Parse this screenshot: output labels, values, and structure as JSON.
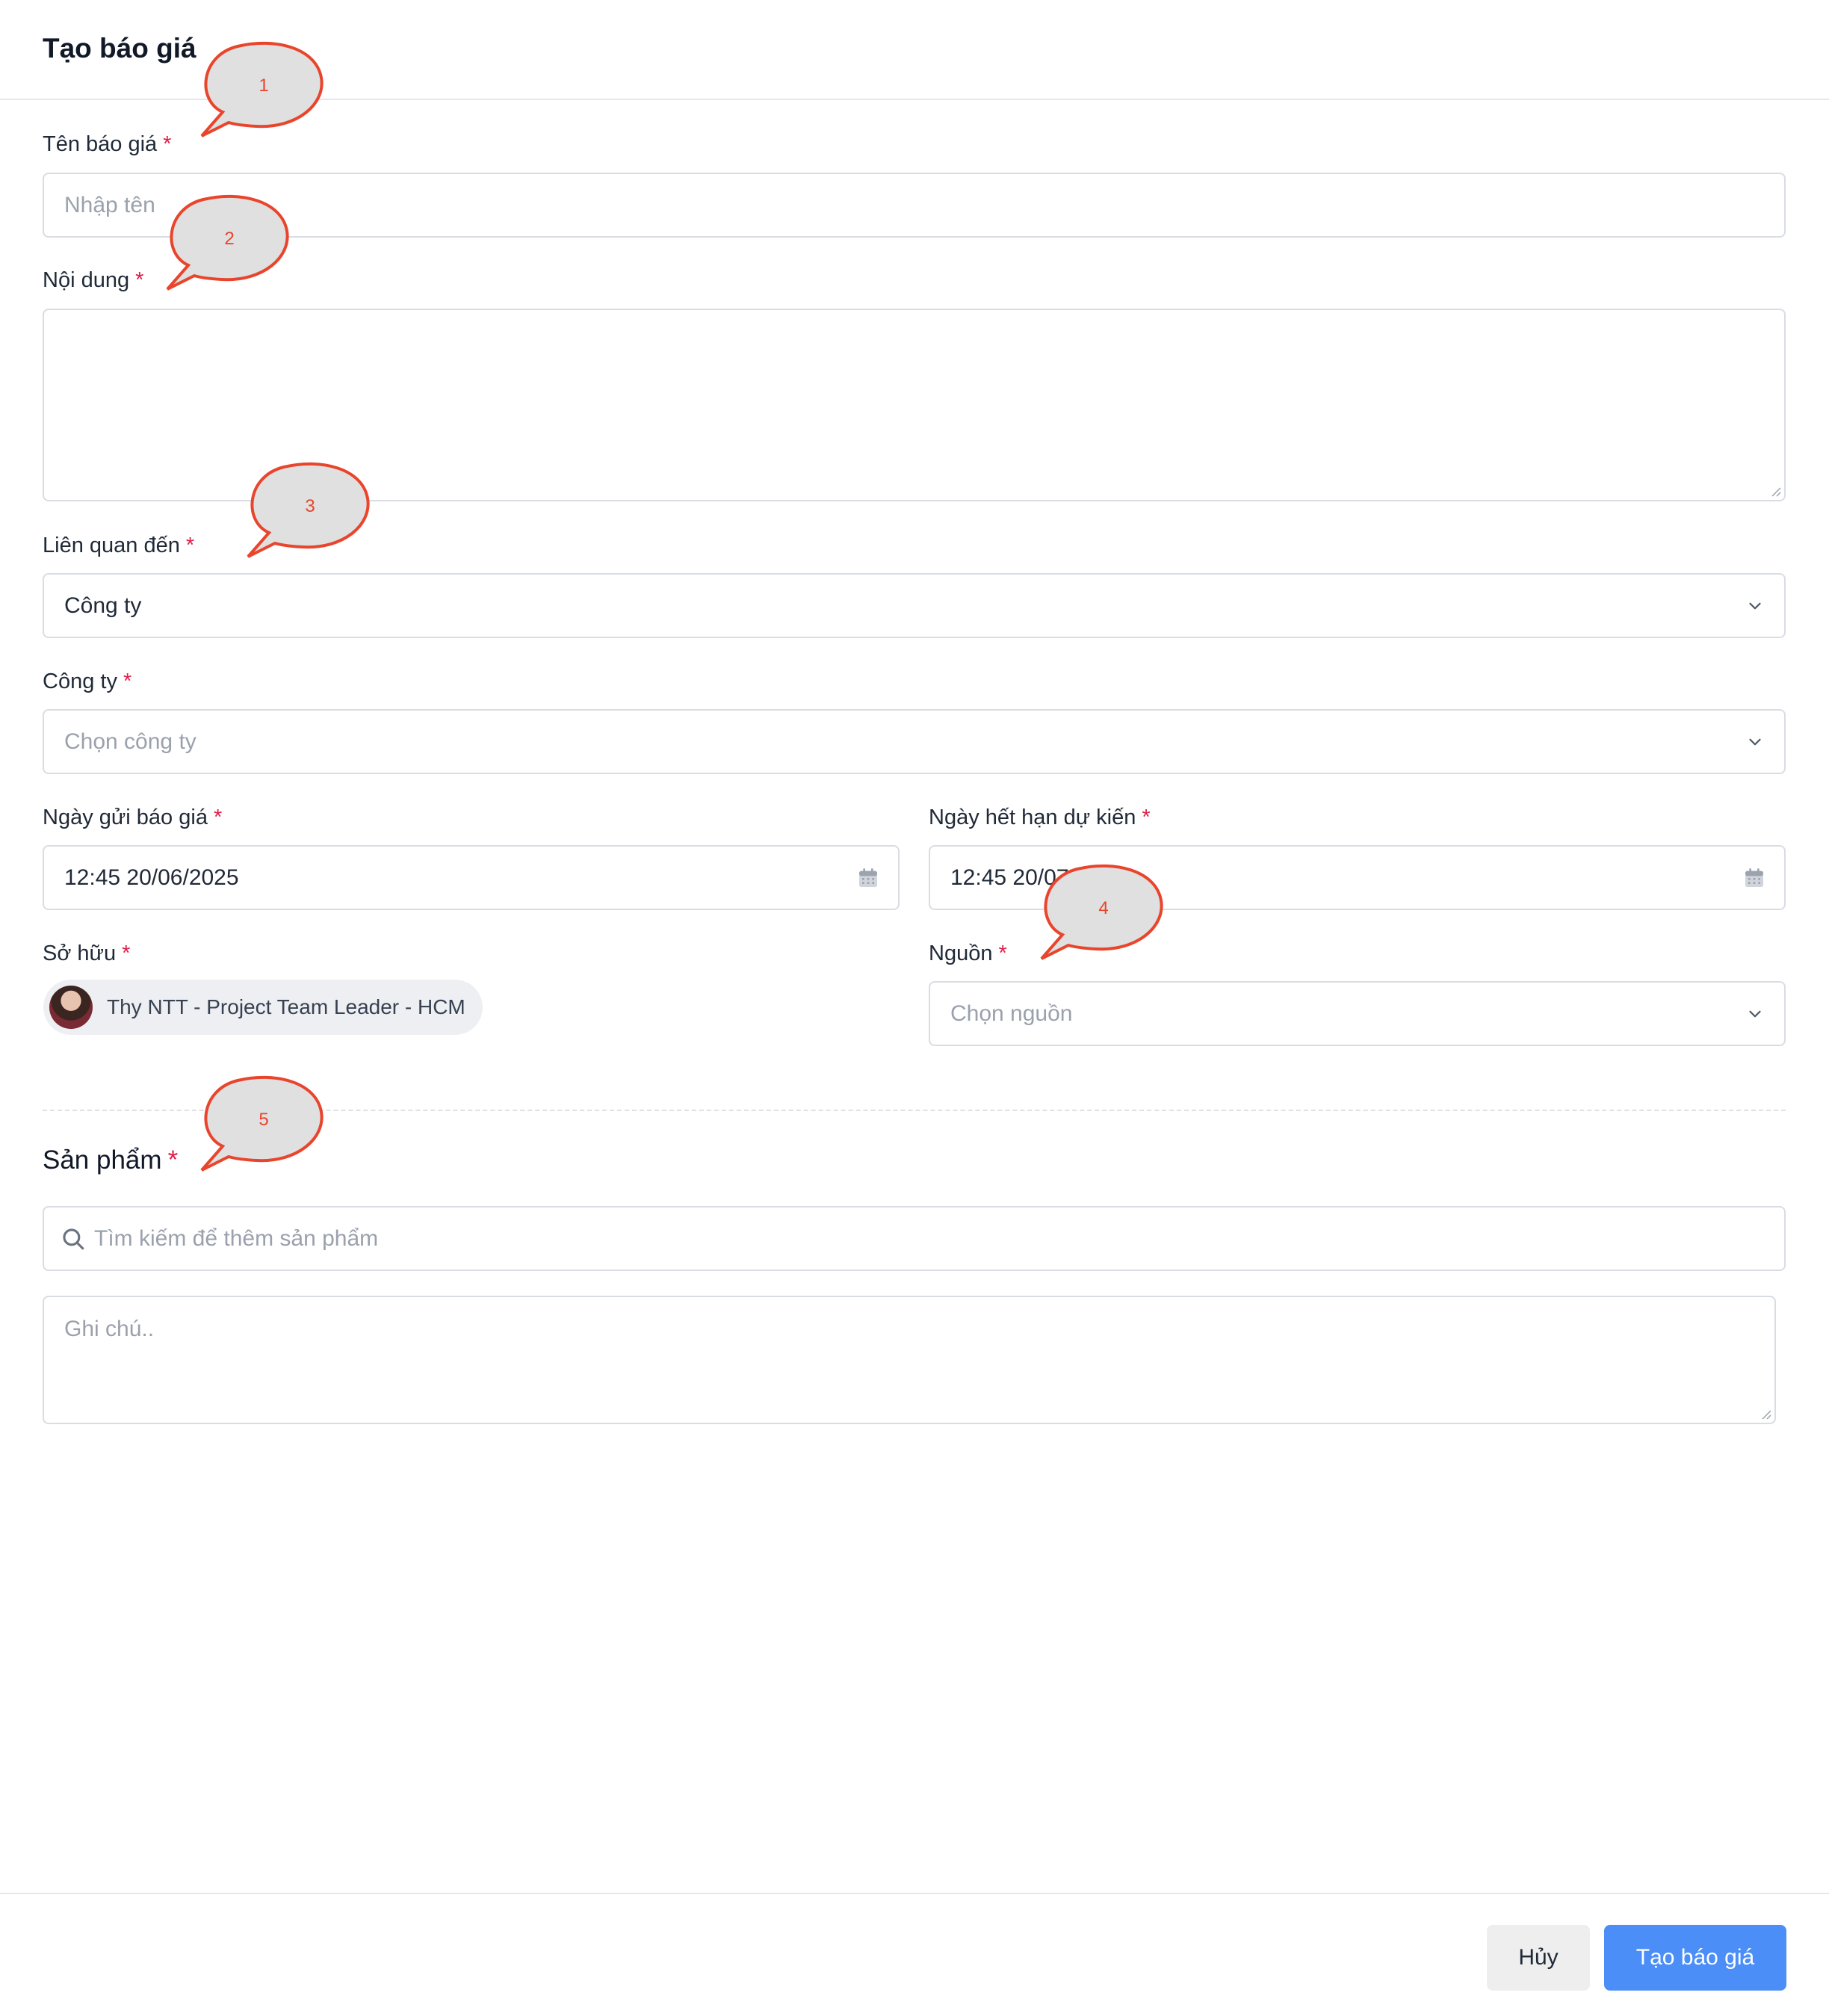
{
  "header": {
    "title": "Tạo báo giá"
  },
  "form": {
    "name_label": "Tên báo giá",
    "name_placeholder": "Nhập tên",
    "content_label": "Nội dung",
    "related_label": "Liên quan đến",
    "related_value": "Công ty",
    "company_label": "Công ty",
    "company_placeholder": "Chọn công ty",
    "send_date_label": "Ngày gửi báo giá",
    "send_date_value": "12:45 20/06/2025",
    "expiry_label": "Ngày hết hạn dự kiến",
    "expiry_value": "12:45 20/07/2025",
    "owner_label": "Sở hữu",
    "owner_name": "Thy NTT - Project Team Leader - HCM",
    "source_label": "Nguồn",
    "source_placeholder": "Chọn nguồn",
    "required_mark": "*"
  },
  "products": {
    "title": "Sản phẩm",
    "search_placeholder": "Tìm kiếm để thêm sản phẩm",
    "note_placeholder": "Ghi chú.."
  },
  "footer": {
    "cancel_label": "Hủy",
    "submit_label": "Tạo báo giá"
  },
  "annotations": [
    "1",
    "2",
    "3",
    "4",
    "5"
  ],
  "colors": {
    "primary": "#4b8ef7",
    "required": "#e11d48",
    "annotation": "#e8452c"
  }
}
